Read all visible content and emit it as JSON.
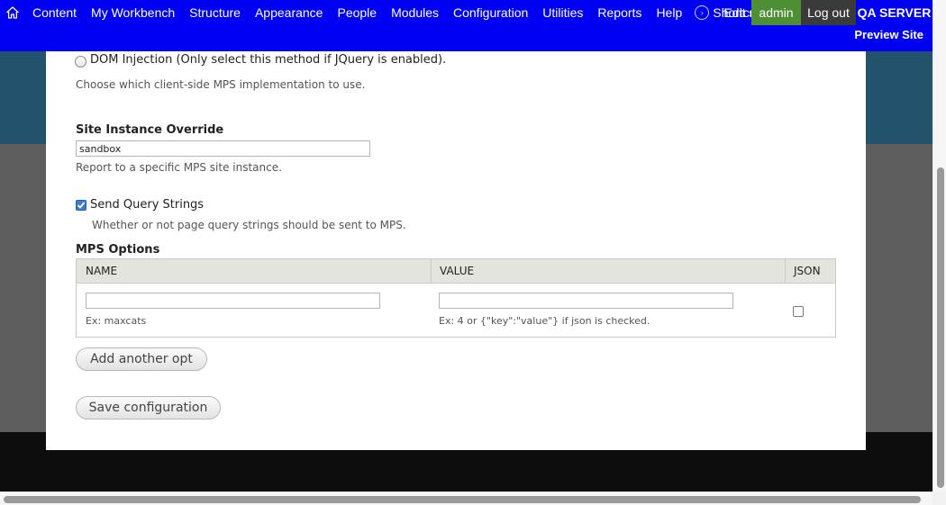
{
  "toolbar": {
    "items": [
      "Content",
      "My Workbench",
      "Structure",
      "Appearance",
      "People",
      "Modules",
      "Configuration",
      "Utilities",
      "Reports",
      "Help"
    ],
    "shortcuts": "Shortcuts",
    "edit_shortcuts": "Edit shortcuts",
    "admin": "admin",
    "logout": "Log out",
    "server": "QA SERVER",
    "preview": "Preview Site"
  },
  "form": {
    "dom_injection_label": "DOM Injection (Only select this method if JQuery is enabled).",
    "implementation_desc": "Choose which client-side MPS implementation to use.",
    "site_instance": {
      "label": "Site Instance Override",
      "value": "sandbox",
      "desc": "Report to a specific MPS site instance."
    },
    "query_strings": {
      "label": "Send Query Strings",
      "desc": "Whether or not page query strings should be sent to MPS.",
      "checked": true
    },
    "mps_options": {
      "heading": "MPS Options",
      "columns": [
        "NAME",
        "VALUE",
        "JSON"
      ],
      "row": {
        "name_value": "",
        "name_example": "Ex: maxcats",
        "value_value": "",
        "value_example": "Ex: 4 or {\"key\":\"value\"} if json is checked.",
        "json_checked": false
      }
    },
    "add_button": "Add another opt",
    "save_button": "Save configuration"
  },
  "colors": {
    "toolbar": "#0000f2",
    "admin": "#4e8f35",
    "logout": "#3a3a3a"
  }
}
